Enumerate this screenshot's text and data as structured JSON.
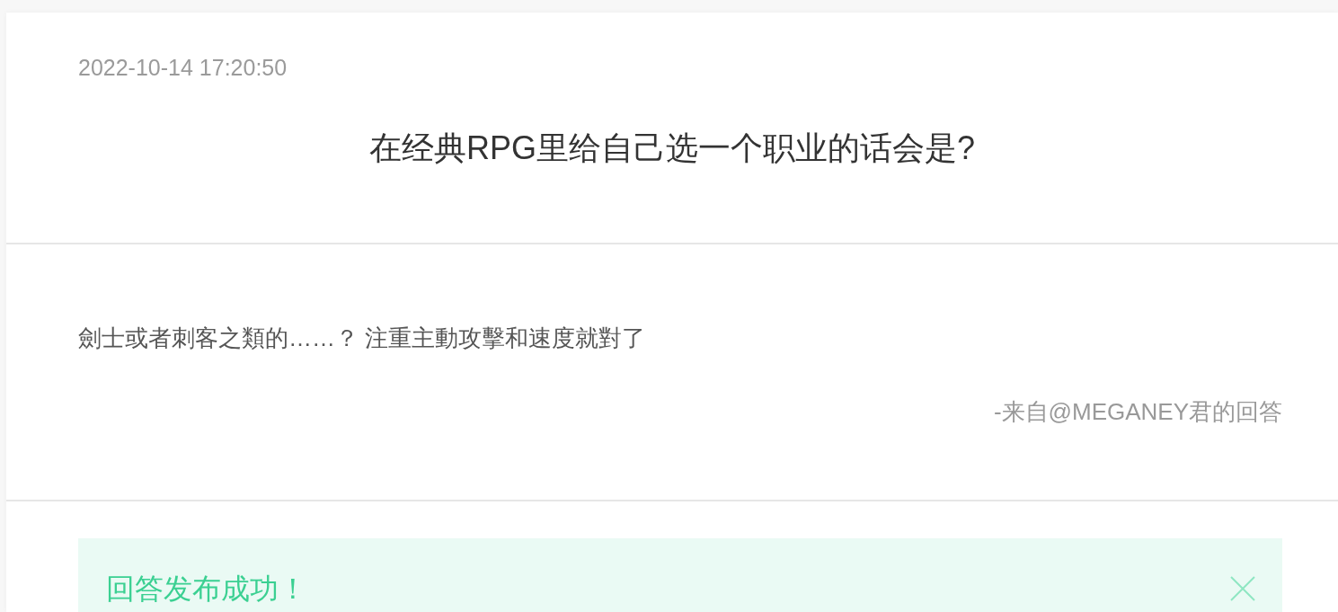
{
  "question": {
    "timestamp": "2022-10-14 17:20:50",
    "title": "在经典RPG里给自己选一个职业的话会是?"
  },
  "answer": {
    "text": "劍士或者刺客之類的……？ 注重主動攻擊和速度就對了",
    "attribution": "-来自@MEGANEY君的回答"
  },
  "alert": {
    "kind": "success",
    "message": "回答发布成功！",
    "closable": true
  }
}
